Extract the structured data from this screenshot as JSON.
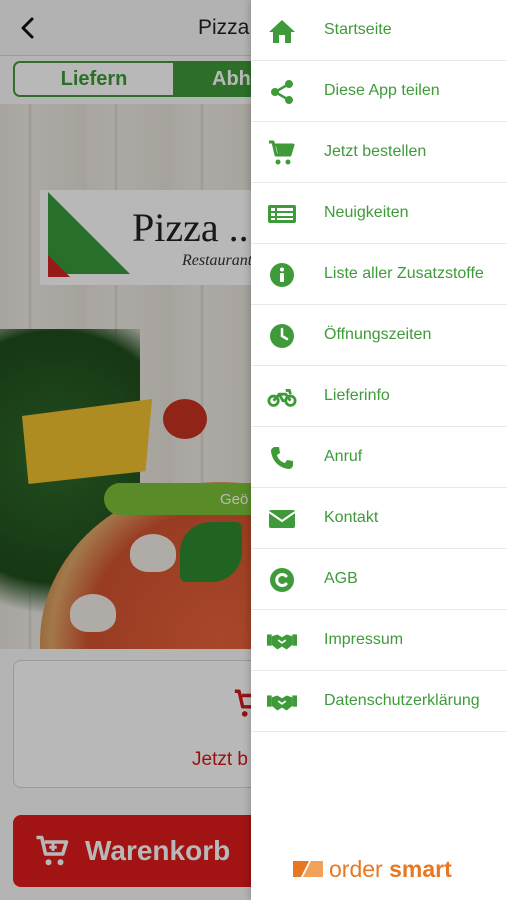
{
  "app": {
    "title": "Pizza ...",
    "tabs": [
      {
        "label": "Liefern",
        "active": false
      },
      {
        "label": "Abholen",
        "active": true
      }
    ],
    "logo": {
      "name": "Pizza ...",
      "subtitle": "Restaurant"
    },
    "hero_button": "Geö",
    "order_card_label": "Jetzt b",
    "basket_label": "Warenkorb"
  },
  "drawer": {
    "items": [
      {
        "label": "Startseite",
        "icon": "home-icon"
      },
      {
        "label": "Diese App teilen",
        "icon": "share-icon"
      },
      {
        "label": "Jetzt bestellen",
        "icon": "cart-icon"
      },
      {
        "label": "Neuigkeiten",
        "icon": "news-icon"
      },
      {
        "label": "Liste aller Zusatzstoffe",
        "icon": "info-icon"
      },
      {
        "label": "Öffnungszeiten",
        "icon": "clock-icon"
      },
      {
        "label": "Lieferinfo",
        "icon": "motorcycle-icon"
      },
      {
        "label": "Anruf",
        "icon": "phone-icon"
      },
      {
        "label": "Kontakt",
        "icon": "envelope-icon"
      },
      {
        "label": "AGB",
        "icon": "copyright-icon"
      },
      {
        "label": "Impressum",
        "icon": "handshake-icon"
      },
      {
        "label": "Datenschutzerklärung",
        "icon": "handshake-icon"
      }
    ],
    "brand": {
      "part1": "order ",
      "part2": "smart"
    }
  },
  "colors": {
    "accent_green": "#3f9a3a",
    "accent_red": "#e11b1b",
    "brand_orange": "#e87722"
  }
}
